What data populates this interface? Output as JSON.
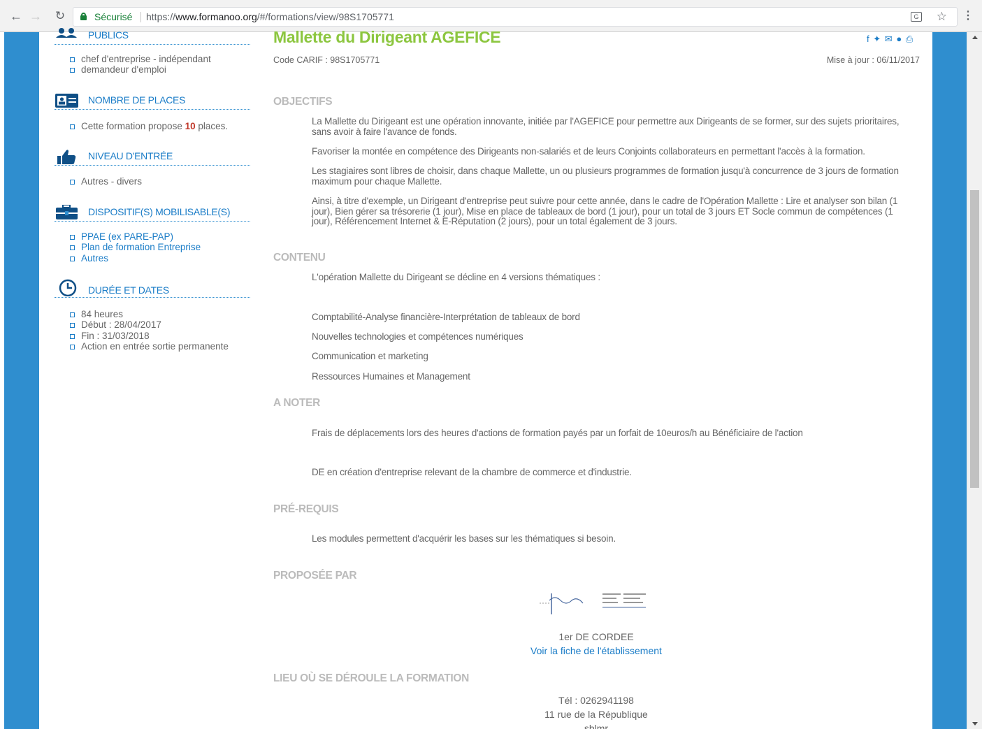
{
  "browser": {
    "secure_label": "Sécurisé",
    "url_scheme": "https://",
    "url_host": "www.formanoo.org",
    "url_path": "/#/formations/view/98S1705771"
  },
  "sidebar": {
    "publics": {
      "title": "PUBLICS",
      "items": [
        "chef d'entreprise - indépendant",
        "demandeur d'emploi"
      ]
    },
    "places": {
      "title": "NOMBRE DE PLACES",
      "text_before": "Cette formation propose ",
      "count": "10",
      "text_after": " places."
    },
    "niveau": {
      "title": "NIVEAU D'ENTRÉE",
      "items": [
        "Autres - divers"
      ]
    },
    "dispositifs": {
      "title": "DISPOSITIF(S) MOBILISABLE(S)",
      "items": [
        "PPAE (ex PARE-PAP)",
        "Plan de formation Entreprise",
        "Autres"
      ]
    },
    "duree": {
      "title": "DURÉE ET DATES",
      "items": [
        "84 heures",
        "Début : 28/04/2017",
        "Fin : 31/03/2018",
        "Action en entrée sortie permanente"
      ]
    }
  },
  "main": {
    "title": "Mallette du Dirigeant AGEFICE",
    "code_carif": "Code CARIF : 98S1705771",
    "mise_a_jour": "Mise à jour : 06/11/2017",
    "objectifs": {
      "heading": "OBJECTIFS",
      "paragraphs": [
        "La Mallette du Dirigeant est une opération innovante, initiée par l'AGEFICE pour permettre aux Dirigeants de se former, sur des sujets prioritaires, sans avoir à faire l'avance de fonds.",
        "Favoriser la montée en compétence des Dirigeants non-salariés et de leurs Conjoints collaborateurs en permettant l'accès à la formation.",
        "Les stagiaires sont libres de choisir, dans chaque Mallette, un ou plusieurs programmes de formation jusqu'à concurrence de 3 jours de formation maximum pour chaque Mallette.",
        "Ainsi, à titre d'exemple, un Dirigeant d'entreprise peut suivre pour cette année, dans le cadre de l'Opération Mallette : Lire et analyser son bilan (1 jour), Bien gérer sa trésorerie (1 jour), Mise en place de tableaux de bord (1 jour), pour un total de 3 jours ET Socle commun de compétences (1 jour), Référencement Internet & E-Réputation (2 jours), pour un total également de 3 jours."
      ]
    },
    "contenu": {
      "heading": "CONTENU",
      "intro": "L'opération Mallette du Dirigeant se décline en 4 versions thématiques :",
      "items": [
        "Comptabilité-Analyse financière-Interprétation de tableaux de bord",
        "Nouvelles technologies et compétences numériques",
        "Communication et marketing",
        "Ressources Humaines et Management"
      ]
    },
    "a_noter": {
      "heading": "A NOTER",
      "paragraphs": [
        "Frais de déplacements lors des heures d'actions de formation payés par un forfait de 10euros/h au Bénéficiaire de l'action",
        "DE en création d'entreprise relevant de la chambre de commerce et d'industrie."
      ]
    },
    "prerequis": {
      "heading": "PRÉ-REQUIS",
      "text": "Les modules permettent d'acquérir les bases sur les thématiques si besoin."
    },
    "proposee": {
      "heading": "PROPOSÉE PAR",
      "name": "1er DE CORDEE",
      "link": "Voir la fiche de l'établissement"
    },
    "lieu": {
      "heading": "LIEU OÙ SE DÉROULE LA FORMATION",
      "tel": "Tél : 0262941198",
      "address": "11 rue de la République",
      "city": "sblmr"
    }
  }
}
